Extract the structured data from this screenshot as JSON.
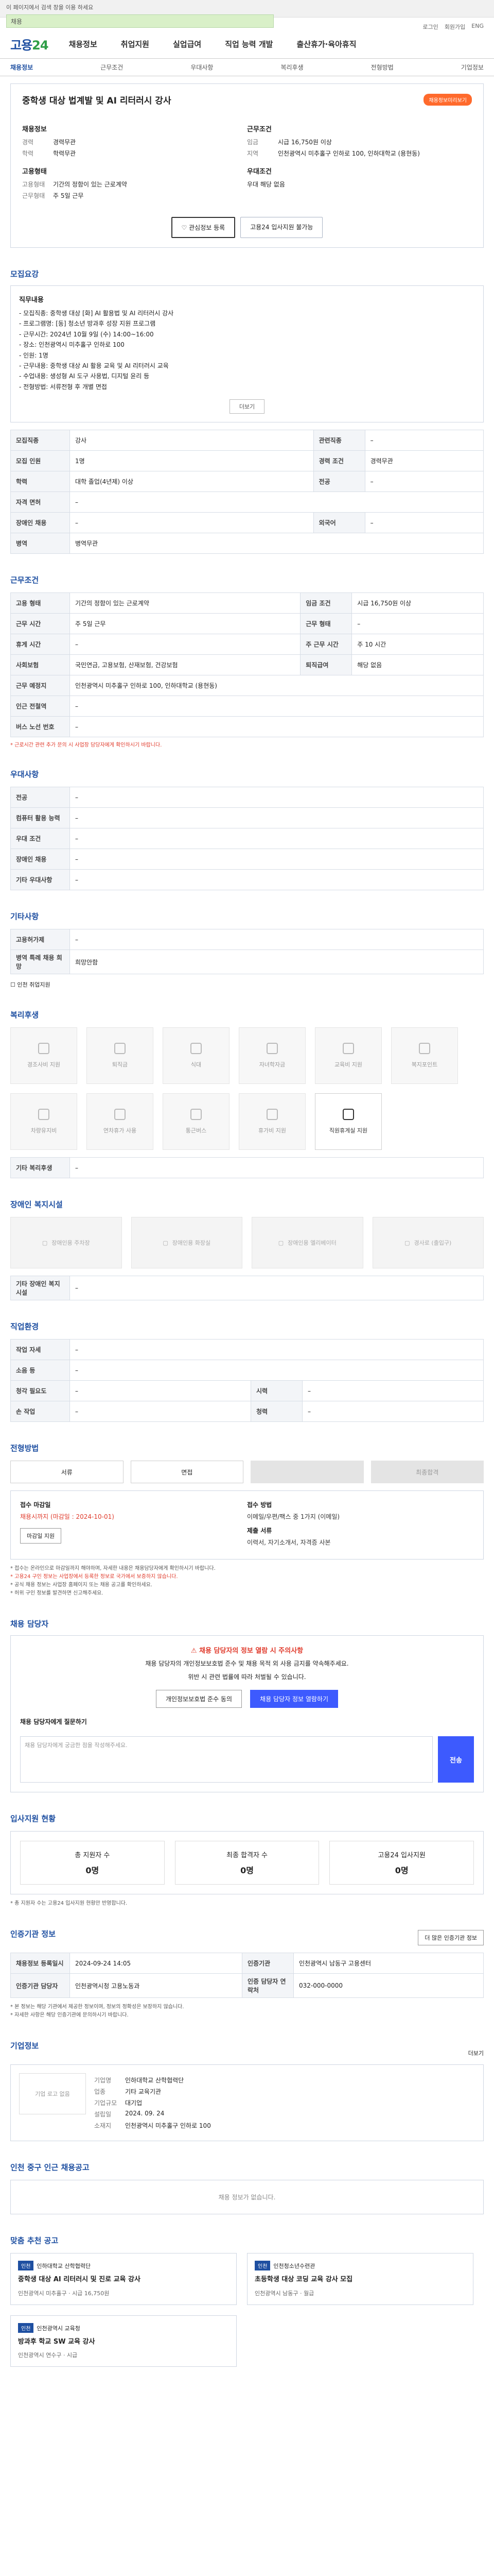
{
  "topbar": {
    "notice": "이 페이지에서 검색 창을 이용 하세요",
    "search_value": "채용"
  },
  "util": [
    "로그인",
    "회원가입",
    "ENG"
  ],
  "brand": {
    "main": "고용",
    "accent": "24"
  },
  "gnb": [
    "채용정보",
    "취업지원",
    "실업급여",
    "직업 능력 개발",
    "출산휴가·육아휴직"
  ],
  "subnav": [
    "채용정보",
    "근무조건",
    "우대사항",
    "복리후생",
    "전형방법",
    "기업정보"
  ],
  "job": {
    "title": "중학생 대상 법계발 및 AI 리터러시 강사",
    "status": "채용정보미리보기",
    "recruit_head": "채용정보",
    "recruit_rows": [
      {
        "k": "경력",
        "v": "경력무관"
      },
      {
        "k": "학력",
        "v": "학력무관"
      }
    ],
    "work_head": "근무조건",
    "work_rows": [
      {
        "k": "임금",
        "v": "시급 16,750원 이상"
      },
      {
        "k": "지역",
        "v": "인천광역시 미추홀구 인하로 100, 인하대학교 (용현동)"
      }
    ],
    "type_head": "고용형태",
    "type_rows": [
      {
        "k": "고용형태",
        "v": "기간의 정함이 있는 근로계약"
      },
      {
        "k": "근무형태",
        "v": "주 5일 근무"
      }
    ],
    "pref_head": "우대조건",
    "pref_rows": [
      {
        "k": "",
        "v": "우대 해당 없음"
      }
    ],
    "btn_scrap": "관심정보 등록",
    "btn_apply": "고용24 입사지원 불가능"
  },
  "s1": {
    "title": "모집요강",
    "box_head": "직무내용",
    "lines": [
      "- 모집직종: 중학생 대상 [화] AI 활용법 및 AI 리터러시 강사",
      "- 프로그램명: [동] 청소년 방과후 성장 지원 프로그램",
      "- 근무시간: 2024년 10월 9일 (수) 14:00~16:00",
      "- 장소: 인천광역시 미추홀구 인하로 100",
      "- 인원: 1명",
      "- 근무내용: 중학생 대상 AI 활용 교육 및 AI 리터러시 교육",
      "- 수업내용: 생성형 AI 도구 사용법, 디지털 윤리 등",
      "- 전형방법: 서류전형 후 개별 면접"
    ],
    "more": "더보기",
    "rows": [
      [
        {
          "k": "모집직종",
          "v": "강사"
        },
        {
          "k": "관련직종",
          "v": "–"
        }
      ],
      [
        {
          "k": "모집 인원",
          "v": "1명"
        },
        {
          "k": "경력 조건",
          "v": "경력무관"
        }
      ],
      [
        {
          "k": "학력",
          "v": "대학 졸업(4년제) 이상"
        },
        {
          "k": "전공",
          "v": "–"
        }
      ],
      [
        {
          "k": "자격 면허",
          "v": "–"
        },
        {
          "k": "",
          "v": ""
        }
      ],
      [
        {
          "k": "장애인 채용",
          "v": "–"
        },
        {
          "k": "외국어",
          "v": "–"
        }
      ],
      [
        {
          "k": "병역",
          "v": "병역무관"
        },
        {
          "k": "",
          "v": ""
        }
      ]
    ]
  },
  "s2": {
    "title": "근무조건",
    "rows": [
      [
        {
          "k": "고용 형태",
          "v": "기간의 정함이 있는 근로계약"
        },
        {
          "k": "임금 조건",
          "v": "시급 16,750원 이상"
        }
      ],
      [
        {
          "k": "근무 시간",
          "v": "주 5일 근무"
        },
        {
          "k": "근무 형태",
          "v": "–"
        }
      ],
      [
        {
          "k": "휴게 시간",
          "v": "–"
        },
        {
          "k": "주 근무 시간",
          "v": "주 10 시간"
        }
      ],
      [
        {
          "k": "사회보험",
          "v": "국민연금, 고용보험, 산재보험, 건강보험"
        },
        {
          "k": "퇴직급여",
          "v": "해당 없음"
        }
      ],
      [
        {
          "k": "근무 예정지",
          "v": "인천광역시 미추홀구 인하로 100, 인하대학교 (용현동)"
        },
        {
          "k": "",
          "v": ""
        }
      ],
      [
        {
          "k": "인근 전철역",
          "v": "–"
        },
        {
          "k": "",
          "v": ""
        }
      ],
      [
        {
          "k": "버스 노선 번호",
          "v": "–"
        },
        {
          "k": "",
          "v": ""
        }
      ]
    ],
    "note": "* 근로시간 관련 추가 문의 시 사업장 담당자에게 확인하시기 바랍니다."
  },
  "s3": {
    "title": "우대사항",
    "rows": [
      {
        "k": "전공",
        "v": "–"
      },
      {
        "k": "컴퓨터 활용 능력",
        "v": "–"
      },
      {
        "k": "우대 조건",
        "v": "–"
      },
      {
        "k": "장애인 채용",
        "v": "–"
      },
      {
        "k": "기타 우대사항",
        "v": "–"
      }
    ]
  },
  "s4": {
    "title": "기타사항",
    "rows": [
      {
        "k": "고용허가제",
        "v": "–"
      },
      {
        "k": "병역 특례 채용 희망",
        "v": "희망안함"
      }
    ],
    "check": "인천 취업지원"
  },
  "s5": {
    "title": "복리후생",
    "tiles": [
      "경조사비 지원",
      "퇴직금",
      "식대",
      "자녀학자금",
      "교육비 지원",
      "복지포인트",
      "차량유지비",
      "연차휴가 사용",
      " 통근버스",
      "휴가비 지원",
      "직원휴게실 지원"
    ],
    "etc_head": "기타 복리후생",
    "etc_val": "–"
  },
  "s6": {
    "title": "장애인 복지시설",
    "tiles": [
      "장애인용 주차장",
      "장애인용 화장실",
      "장애인용 엘리베이터",
      "경사로 (출입구)"
    ],
    "etc_head": "기타 장애인 복지시설",
    "etc_val": "–"
  },
  "s7": {
    "title": "직업환경",
    "rows": [
      [
        {
          "k": "작업 자세",
          "v": "–"
        },
        {
          "k": "",
          "v": ""
        }
      ],
      [
        {
          "k": "소음 등",
          "v": "–"
        },
        {
          "k": "",
          "v": ""
        }
      ],
      [
        {
          "k": "청각 필요도",
          "v": "–"
        },
        {
          "k": "시력",
          "v": "–"
        }
      ],
      [
        {
          "k": "손 작업",
          "v": "–"
        },
        {
          "k": "청력",
          "v": "–"
        }
      ]
    ]
  },
  "s8": {
    "title": "전형방법",
    "steps": [
      "서류",
      "면접",
      "",
      "최종합격"
    ]
  },
  "apply": {
    "c1_lbl": "접수 마감일",
    "c1_val": "채용시까지 (마감일 : 2024-10-01)",
    "c1_btn": "마감일 지원",
    "c2_lbl": "접수 방법",
    "c2_val": "이메일/우편/팩스 중 1가지 (이메일)",
    "c3_lbl": "제출 서류",
    "c3_val": "이력서, 자기소개서, 자격증 사본"
  },
  "apply_notes": [
    "* 접수는 온라인으로 마감일까지 해야하며, 자세한 내용은 채용담당자에게 확인하시기 바랍니다.",
    "* 고용24 구인 정보는 사업장에서 등록한 정보로 국가에서 보증하지 않습니다.",
    "* 공식 채용 정보는 사업장 홈페이지 또는 채용 공고를 확인하세요.",
    "* 허위 구인 정보를 발견하면 신고해주세요."
  ],
  "s9": {
    "title": "채용 담당자",
    "alert": "채용 담당자의 정보 열람 시 주의사항",
    "sub1": "채용 담당자의 개인정보보호법 준수 및 채용 목적 외 사용 금지를 약속해주세요.",
    "sub2": "위반 시 관련 법률에 따라 처벌될 수 있습니다.",
    "b1": "개인정보보호법 준수 동의",
    "b2": "채용 담당자 정보 열람하기",
    "q_head": "채용 담당자에게 질문하기",
    "q_ph": "채용 담당자에게 궁금한 점을 작성해주세요.",
    "q_btn": "전송"
  },
  "s10": {
    "title": "입사지원 현황",
    "stats": [
      {
        "l": "총 지원자 수",
        "n": "0명"
      },
      {
        "l": "최종 합격자 수",
        "n": "0명"
      },
      {
        "l": "고용24 입사지원",
        "n": "0명"
      }
    ],
    "note": "* 총 지원자 수는 고용24 입사지원 현황만 반영합니다."
  },
  "s11": {
    "title": "인증기관 정보",
    "btn": "더 많은 인증기관 정보",
    "rows": [
      [
        {
          "k": "채용정보 등록일시",
          "v": "2024-09-24 14:05"
        },
        {
          "k": "인증기관",
          "v": "인천광역시 남동구 고용센터"
        }
      ],
      [
        {
          "k": "인증기관 담당자",
          "v": "인천광역시청 고용노동과"
        },
        {
          "k": "인증 담당자 연락처",
          "v": "032-000-0000"
        }
      ]
    ],
    "notes": [
      "* 본 정보는 해당 기관에서 제공한 정보이며, 정보의 정확성은 보장하지 않습니다.",
      "* 자세한 사항은 해당 인증기관에 문의하시기 바랍니다."
    ]
  },
  "s12": {
    "title": "기업정보",
    "more": "더보기",
    "logo": "기업 로고 없음",
    "rows": [
      {
        "k": "기업명",
        "v": "인하대학교 산학협력단"
      },
      {
        "k": "업종",
        "v": "기타 교육기관"
      },
      {
        "k": "기업규모",
        "v": "대기업"
      },
      {
        "k": "설립일",
        "v": "2024. 09. 24"
      },
      {
        "k": "소재지",
        "v": "인천광역시 미추홀구 인하로 100"
      }
    ]
  },
  "s13": {
    "title": "인천 중구 인근 채용공고",
    "empty": "채용 정보가 없습니다."
  },
  "s14": {
    "title": "맞춤 추천 공고",
    "cards": [
      {
        "badge": "인천",
        "org": "인하대학교 산학협력단",
        "t": "중학생 대상 AI 리터러시 및 진로 교육 강사",
        "m": "인천광역시 미추홀구 · 시급 16,750원"
      },
      {
        "badge": "인천",
        "org": "인천청소년수련관",
        "t": "초등학생 대상 코딩 교육 강사 모집",
        "m": "인천광역시 남동구 · 월급"
      },
      {
        "badge": "인천",
        "org": "인천광역시 교육청",
        "t": "방과후 학교 SW 교육 강사",
        "m": "인천광역시 연수구 · 시급"
      }
    ]
  }
}
